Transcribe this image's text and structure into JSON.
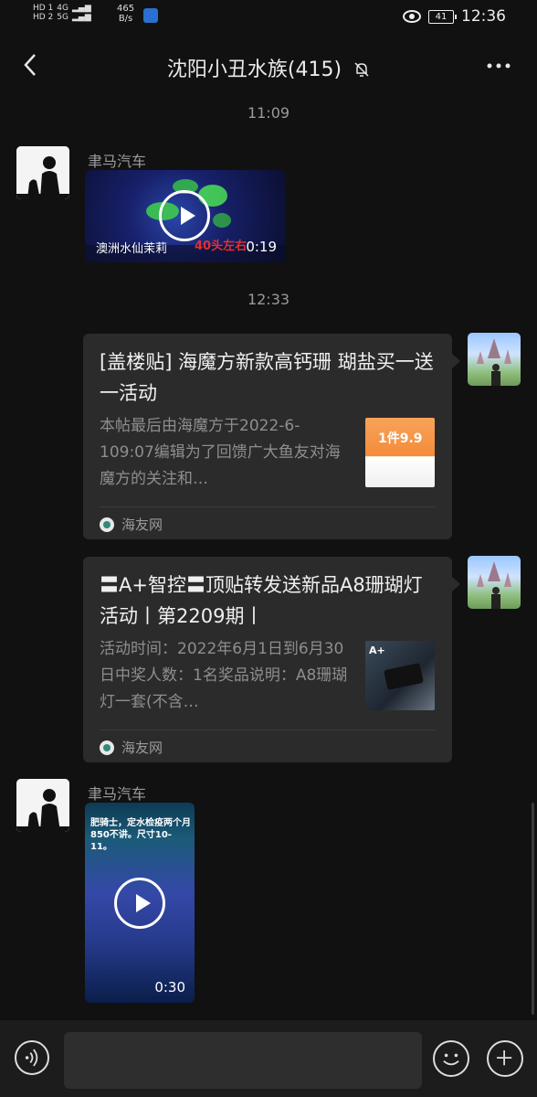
{
  "status_bar": {
    "sim1": "HD 1",
    "sim2": "HD 2",
    "signal1": "4G",
    "signal2": "5G",
    "net_speed": "465",
    "net_unit": "B/s",
    "battery": "41",
    "clock": "12:36",
    "icons": [
      "eye-icon",
      "battery-icon",
      "shield-icon"
    ]
  },
  "header": {
    "title": "沈阳小丑水族(415)",
    "icons": [
      "back-arrow-icon",
      "mute-bell-icon",
      "more-dots-icon"
    ]
  },
  "messages": [
    {
      "type": "time",
      "text": "11:09"
    },
    {
      "type": "video",
      "sender": "聿马汽车",
      "caption": "澳洲水仙茉莉",
      "caption2": "40头左右",
      "duration": "0:19"
    },
    {
      "type": "time",
      "text": "12:33"
    },
    {
      "type": "link_card",
      "title": "[盖楼贴] 海魔方新款高钙珊 瑚盐买一送一活动",
      "description": "本帖最后由海魔方于2022-6-109:07编辑为了回馈广大鱼友对海魔方的关注和…",
      "thumb_text": "1件9.9",
      "source": "海友网"
    },
    {
      "type": "link_card",
      "title": "〓A+智控〓顶贴转发送新品A8珊瑚灯活动丨第2209期丨",
      "description": "活动时间：2022年6月1日到6月30日中奖人数：1名奖品说明：A8珊瑚灯一套(不含…",
      "thumb_text": "A+",
      "source": "海友网"
    },
    {
      "type": "video",
      "sender": "聿马汽车",
      "overlay_text": "肥骑士，定水检疫两个月850不讲。尺寸10-11。",
      "duration": "0:30"
    }
  ],
  "input_bar": {
    "placeholder": "",
    "icons": [
      "voice-icon",
      "emoji-icon",
      "plus-icon"
    ]
  },
  "colors": {
    "background": "#111111",
    "bubble": "#2b2b2b",
    "timestamp": "#9a9a9a"
  }
}
